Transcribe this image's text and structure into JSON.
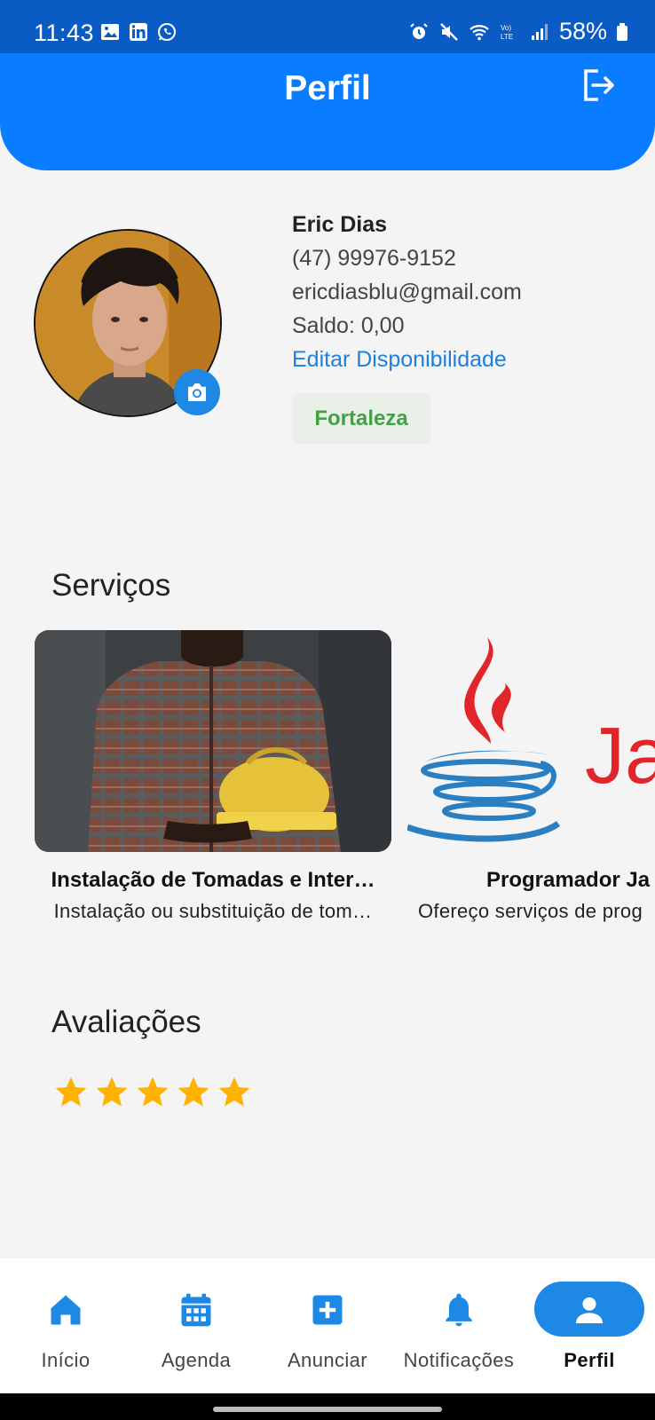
{
  "status_bar": {
    "time": "11:43",
    "battery": "58%"
  },
  "header": {
    "title": "Perfil"
  },
  "profile": {
    "name": "Eric Dias",
    "phone": "(47) 99976-9152",
    "email": "ericdiasblu@gmail.com",
    "balance": "Saldo: 0,00",
    "edit_link": "Editar Disponibilidade",
    "city": "Fortaleza"
  },
  "services": {
    "title": "Serviços",
    "items": [
      {
        "title": "Instalação de Tomadas e Inter…",
        "description": "Instalação ou substituição de tom…"
      },
      {
        "title": "Programador Ja",
        "description": "Ofereço serviços de prog"
      }
    ]
  },
  "reviews": {
    "title": "Avaliações",
    "rating": 5,
    "max_rating": 5
  },
  "nav": {
    "items": [
      {
        "label": "Início",
        "icon": "home-icon"
      },
      {
        "label": "Agenda",
        "icon": "calendar-icon"
      },
      {
        "label": "Anunciar",
        "icon": "add-box-icon"
      },
      {
        "label": "Notificações",
        "icon": "bell-icon"
      },
      {
        "label": "Perfil",
        "icon": "person-icon"
      }
    ],
    "active_index": 4
  },
  "colors": {
    "primary": "#0a7cff",
    "status_bar": "#0a5bc4",
    "link": "#1e7fe0",
    "city_text": "#43a047",
    "star": "#ffb300"
  }
}
